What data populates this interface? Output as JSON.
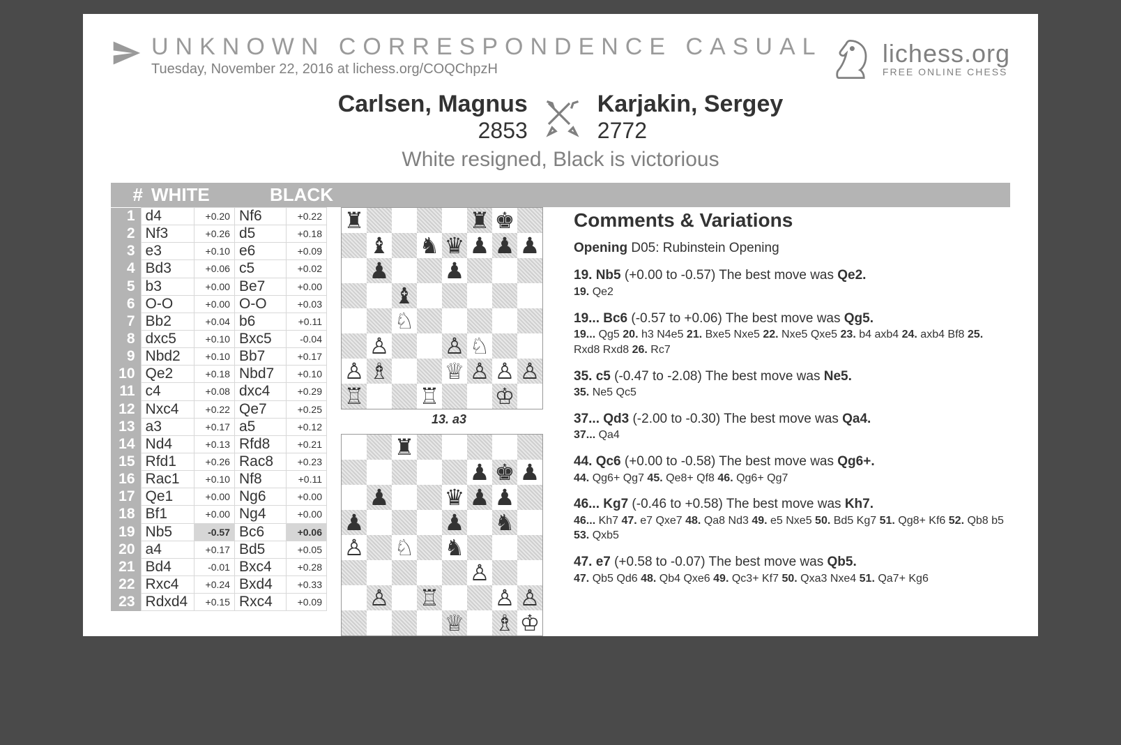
{
  "header": {
    "title": "UNKNOWN CORRESPONDENCE CASUAL",
    "subtitle": "Tuesday, November 22, 2016 at lichess.org/COQChpzH"
  },
  "brand": {
    "name": "lichess.org",
    "tag": "FREE ONLINE CHESS"
  },
  "white": {
    "name": "Carlsen, Magnus",
    "rating": "2853"
  },
  "black": {
    "name": "Karjakin, Sergey",
    "rating": "2772"
  },
  "result": "White resigned, Black is victorious",
  "cols": {
    "num": "#",
    "white": "WHITE",
    "black": "BLACK"
  },
  "moves": [
    {
      "n": "1",
      "w": "d4",
      "we": "+0.20",
      "b": "Nf6",
      "be": "+0.22"
    },
    {
      "n": "2",
      "w": "Nf3",
      "we": "+0.26",
      "b": "d5",
      "be": "+0.18"
    },
    {
      "n": "3",
      "w": "e3",
      "we": "+0.10",
      "b": "e6",
      "be": "+0.09"
    },
    {
      "n": "4",
      "w": "Bd3",
      "we": "+0.06",
      "b": "c5",
      "be": "+0.02"
    },
    {
      "n": "5",
      "w": "b3",
      "we": "+0.00",
      "b": "Be7",
      "be": "+0.00"
    },
    {
      "n": "6",
      "w": "O-O",
      "we": "+0.00",
      "b": "O-O",
      "be": "+0.03"
    },
    {
      "n": "7",
      "w": "Bb2",
      "we": "+0.04",
      "b": "b6",
      "be": "+0.11"
    },
    {
      "n": "8",
      "w": "dxc5",
      "we": "+0.10",
      "b": "Bxc5",
      "be": "-0.04"
    },
    {
      "n": "9",
      "w": "Nbd2",
      "we": "+0.10",
      "b": "Bb7",
      "be": "+0.17"
    },
    {
      "n": "10",
      "w": "Qe2",
      "we": "+0.18",
      "b": "Nbd7",
      "be": "+0.10"
    },
    {
      "n": "11",
      "w": "c4",
      "we": "+0.08",
      "b": "dxc4",
      "be": "+0.29"
    },
    {
      "n": "12",
      "w": "Nxc4",
      "we": "+0.22",
      "b": "Qe7",
      "be": "+0.25"
    },
    {
      "n": "13",
      "w": "a3",
      "we": "+0.17",
      "b": "a5",
      "be": "+0.12"
    },
    {
      "n": "14",
      "w": "Nd4",
      "we": "+0.13",
      "b": "Rfd8",
      "be": "+0.21"
    },
    {
      "n": "15",
      "w": "Rfd1",
      "we": "+0.26",
      "b": "Rac8",
      "be": "+0.23"
    },
    {
      "n": "16",
      "w": "Rac1",
      "we": "+0.10",
      "b": "Nf8",
      "be": "+0.11"
    },
    {
      "n": "17",
      "w": "Qe1",
      "we": "+0.00",
      "b": "Ng6",
      "be": "+0.00"
    },
    {
      "n": "18",
      "w": "Bf1",
      "we": "+0.00",
      "b": "Ng4",
      "be": "+0.00"
    },
    {
      "n": "19",
      "w": "Nb5",
      "we": "-0.57",
      "b": "Bc6",
      "be": "+0.06",
      "hl": true
    },
    {
      "n": "20",
      "w": "a4",
      "we": "+0.17",
      "b": "Bd5",
      "be": "+0.05"
    },
    {
      "n": "21",
      "w": "Bd4",
      "we": "-0.01",
      "b": "Bxc4",
      "be": "+0.28"
    },
    {
      "n": "22",
      "w": "Rxc4",
      "we": "+0.24",
      "b": "Bxd4",
      "be": "+0.33"
    },
    {
      "n": "23",
      "w": "Rdxd4",
      "we": "+0.15",
      "b": "Rxc4",
      "be": "+0.09"
    }
  ],
  "board1": {
    "caption": "13. a3",
    "rows": [
      "r....rk.",
      ".b.nqppp",
      ".p..p...",
      "..b.....",
      "..N.....",
      ".P..PN..",
      "PB..QPPP",
      "R..R..K."
    ]
  },
  "board2": {
    "rows": [
      "..r.....",
      ".....pkp",
      ".p..qpp.",
      "p...p.n.",
      "P.N.n...",
      ".....P..",
      ".P.R..PP",
      "....Q.BK"
    ]
  },
  "comments": {
    "heading": "Comments & Variations",
    "opening_lead": "Opening",
    "opening": "D05: Rubinstein Opening",
    "items": [
      {
        "head": "19. Nb5",
        "range": "(+0.00 to -0.57)",
        "best": "Qe2.",
        "line": "19. Qe2"
      },
      {
        "head": "19... Bc6",
        "range": "(-0.57 to +0.06)",
        "best": "Qg5.",
        "line": "19... Qg5 20. h3 N4e5 21. Bxe5 Nxe5 22. Nxe5 Qxe5 23. b4 axb4 24. axb4 Bf8 25. Rxd8 Rxd8 26. Rc7"
      },
      {
        "head": "35. c5",
        "range": "(-0.47 to -2.08)",
        "best": "Ne5.",
        "line": "35. Ne5 Qc5"
      },
      {
        "head": "37... Qd3",
        "range": "(-2.00 to -0.30)",
        "best": "Qa4.",
        "line": "37... Qa4"
      },
      {
        "head": "44. Qc6",
        "range": "(+0.00 to -0.58)",
        "best": "Qg6+.",
        "line": "44. Qg6+ Qg7 45. Qe8+ Qf8 46. Qg6+ Qg7"
      },
      {
        "head": "46... Kg7",
        "range": "(-0.46 to +0.58)",
        "best": "Kh7.",
        "line": "46... Kh7 47. e7 Qxe7 48. Qa8 Nd3 49. e5 Nxe5 50. Bd5 Kg7 51. Qg8+ Kf6 52. Qb8 b5 53. Qxb5"
      },
      {
        "head": "47. e7",
        "range": "(+0.58 to -0.07)",
        "best": "Qb5.",
        "line": "47. Qb5 Qd6 48. Qb4 Qxe6 49. Qc3+ Kf7 50. Qxa3 Nxe4 51. Qa7+ Kg6"
      }
    ],
    "best_label": "The best move was"
  }
}
